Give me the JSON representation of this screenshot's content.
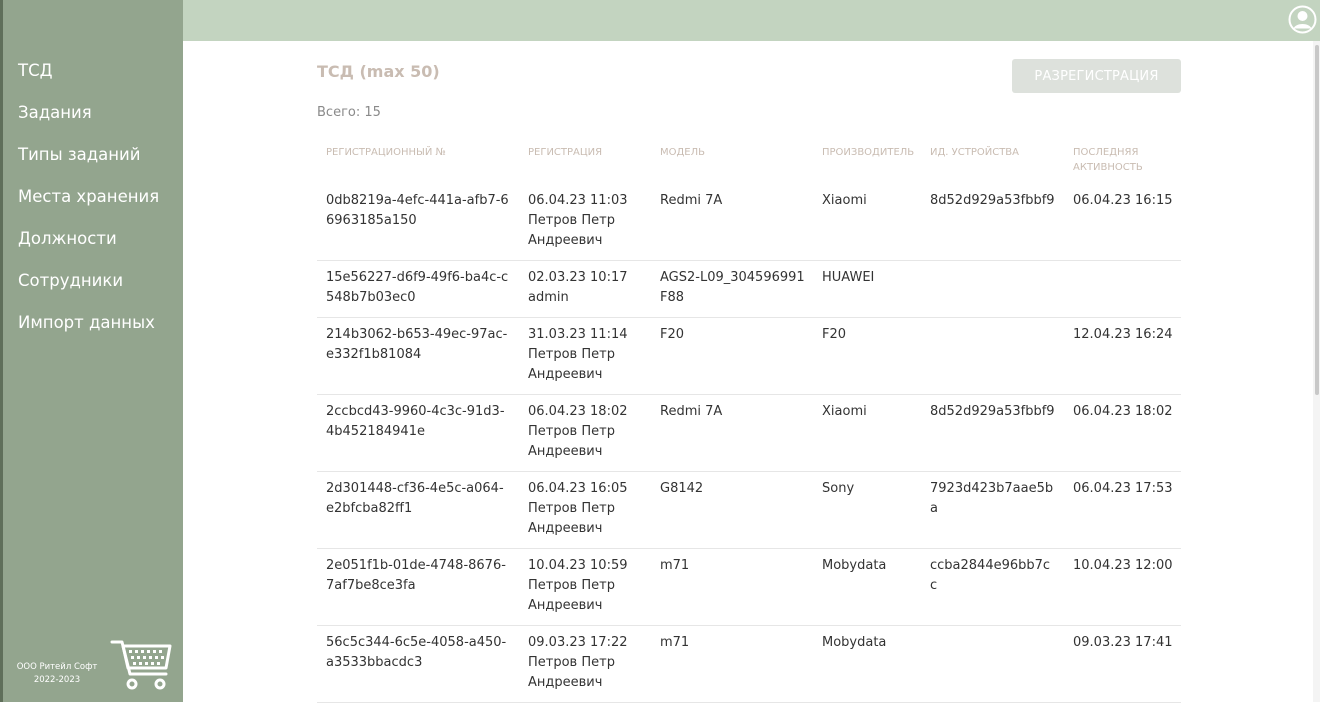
{
  "sidebar": {
    "items": [
      {
        "label": "ТСД"
      },
      {
        "label": "Задания"
      },
      {
        "label": "Типы заданий"
      },
      {
        "label": "Места хранения"
      },
      {
        "label": "Должности"
      },
      {
        "label": "Сотрудники"
      },
      {
        "label": "Импорт данных"
      }
    ],
    "footer_company": "ООО Ритейл Софт",
    "footer_years": "2022-2023"
  },
  "page": {
    "title": "ТСД (max 50)",
    "count": "Всего: 15",
    "unregister_label": "РАЗРЕГИСТРАЦИЯ"
  },
  "table": {
    "headers": [
      "РЕГИСТРАЦИОННЫЙ №",
      "РЕГИСТРАЦИЯ",
      "МОДЕЛЬ",
      "ПРОИЗВОДИТЕЛЬ",
      "ИД. УСТРОЙСТВА",
      "ПОСЛЕДНЯЯ АКТИВНОСТЬ"
    ],
    "rows": [
      {
        "reg_no": "0db8219a-4efc-441a-afb7-66963185a150",
        "reg_date": "06.04.23 11:03",
        "reg_user": "Петров Петр Андреевич",
        "model": "Redmi 7A",
        "vendor": "Xiaomi",
        "device_id": "8d52d929a53fbbf9",
        "last_activity": "06.04.23 16:15"
      },
      {
        "reg_no": "15e56227-d6f9-49f6-ba4c-c548b7b03ec0",
        "reg_date": "02.03.23 10:17",
        "reg_user": "admin",
        "model": "AGS2-L09_304596991F88",
        "vendor": "HUAWEI",
        "device_id": "",
        "last_activity": ""
      },
      {
        "reg_no": "214b3062-b653-49ec-97ac-e332f1b81084",
        "reg_date": "31.03.23 11:14",
        "reg_user": "Петров Петр Андреевич",
        "model": "F20",
        "vendor": "F20",
        "device_id": "",
        "last_activity": "12.04.23 16:24"
      },
      {
        "reg_no": "2ccbcd43-9960-4c3c-91d3-4b452184941e",
        "reg_date": "06.04.23 18:02",
        "reg_user": "Петров Петр Андреевич",
        "model": "Redmi 7A",
        "vendor": "Xiaomi",
        "device_id": "8d52d929a53fbbf9",
        "last_activity": "06.04.23 18:02"
      },
      {
        "reg_no": "2d301448-cf36-4e5c-a064-e2bfcba82ff1",
        "reg_date": "06.04.23 16:05",
        "reg_user": "Петров Петр Андреевич",
        "model": "G8142",
        "vendor": "Sony",
        "device_id": "7923d423b7aae5ba",
        "last_activity": "06.04.23 17:53"
      },
      {
        "reg_no": "2e051f1b-01de-4748-8676-7af7be8ce3fa",
        "reg_date": "10.04.23 10:59",
        "reg_user": "Петров Петр Андреевич",
        "model": "m71",
        "vendor": "Mobydata",
        "device_id": "ccba2844e96bb7cc",
        "last_activity": "10.04.23 12:00"
      },
      {
        "reg_no": "56c5c344-6c5e-4058-a450-a3533bbacdc3",
        "reg_date": "09.03.23 17:22",
        "reg_user": "Петров Петр Андреевич",
        "model": "m71",
        "vendor": "Mobydata",
        "device_id": "",
        "last_activity": "09.03.23 17:41"
      }
    ]
  },
  "icons": {
    "user": "user-circle-icon",
    "cart": "shopping-cart-icon"
  },
  "colors": {
    "sidebar_bg": "#93a58e",
    "topbar_bg": "#c3d4c0",
    "header_text": "#c9bcb2",
    "button_bg": "#dde1dc"
  }
}
